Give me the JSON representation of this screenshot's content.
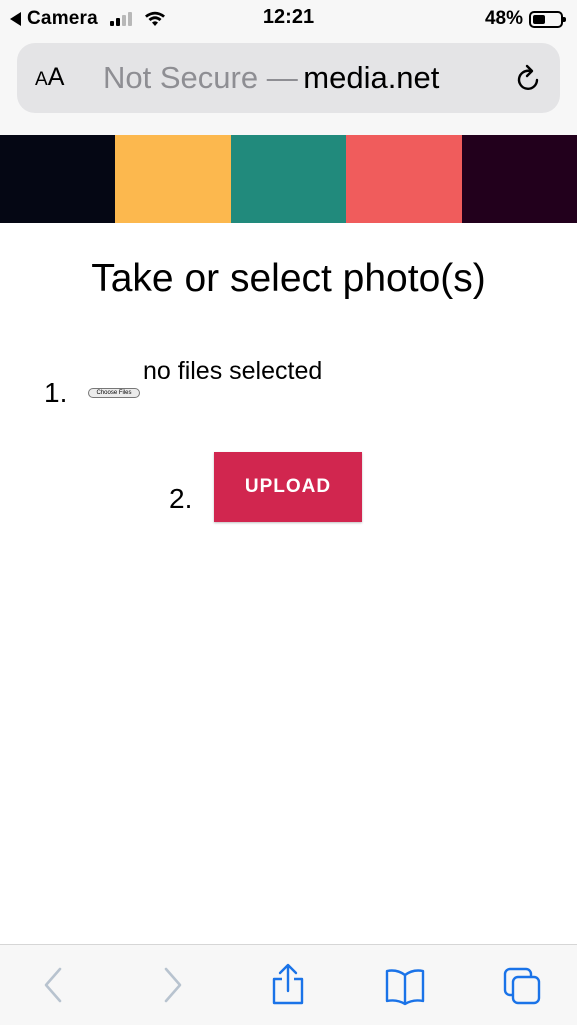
{
  "status_bar": {
    "back_app": "Camera",
    "time": "12:21",
    "battery": "48%",
    "battery_level": 0.48
  },
  "browser": {
    "text_size_label": "AA",
    "url_security": "Not Secure —",
    "url_domain": "media.net",
    "icons": [
      "back-arrow-icon",
      "forward-arrow-icon",
      "share-icon",
      "bookmarks-icon",
      "tabs-icon",
      "reload-icon"
    ]
  },
  "colors": {
    "band": [
      "#050714",
      "#fcb84e",
      "#218a7c",
      "#f05c5c",
      "#22001c"
    ],
    "upload_button": "#d1264f"
  },
  "page": {
    "title": "Take or select photo(s)",
    "step1_number": "1.",
    "choose_files_label": "Choose Files",
    "file_status": "no files selected",
    "step2_number": "2.",
    "upload_label": "UPLOAD"
  }
}
